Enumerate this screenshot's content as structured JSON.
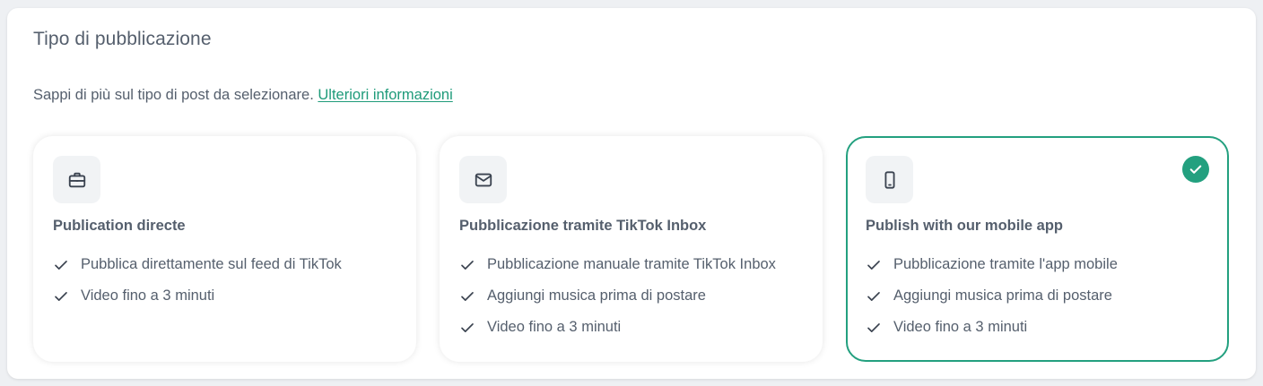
{
  "section": {
    "title": "Tipo di pubblicazione",
    "subtitle_text": "Sappi di più sul tipo di post da selezionare.",
    "learn_more_link": "Ulteriori informazioni"
  },
  "options": [
    {
      "icon": "briefcase-icon",
      "title": "Publication directe",
      "selected": false,
      "features": [
        "Pubblica direttamente sul feed di TikTok",
        "Video fino a 3 minuti"
      ]
    },
    {
      "icon": "mail-icon",
      "title": "Pubblicazione tramite TikTok Inbox",
      "selected": false,
      "features": [
        "Pubblicazione manuale tramite TikTok Inbox",
        "Aggiungi musica prima di postare",
        "Video fino a 3 minuti"
      ]
    },
    {
      "icon": "mobile-phone-icon",
      "title": "Publish with our mobile app",
      "selected": true,
      "features": [
        "Pubblicazione tramite l'app mobile",
        "Aggiungi musica prima di postare",
        "Video fino a 3 minuti"
      ]
    }
  ],
  "colors": {
    "accent": "#23a07f",
    "link": "#1f9b7a",
    "text": "#555f6d",
    "icon_bg": "#f1f3f5"
  }
}
